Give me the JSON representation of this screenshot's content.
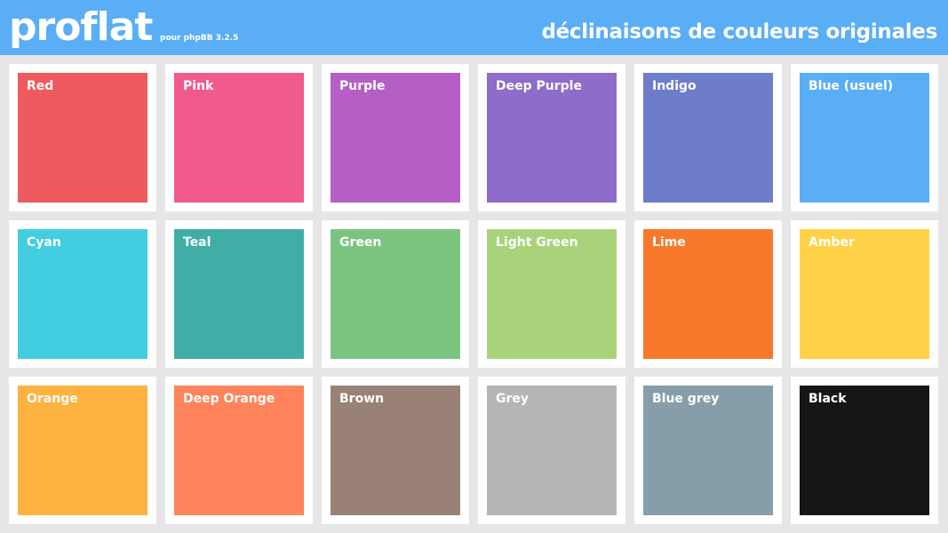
{
  "header": {
    "logo": "proflat",
    "subtitle": "pour phpBB 3.2.5",
    "title": "déclinaisons de couleurs originales",
    "background": "#5aaef6"
  },
  "swatches": [
    {
      "label": "Red",
      "color": "#ee5a5d"
    },
    {
      "label": "Pink",
      "color": "#f05a8c"
    },
    {
      "label": "Purple",
      "color": "#b45ec6"
    },
    {
      "label": "Deep Purple",
      "color": "#8e6cc9"
    },
    {
      "label": "Indigo",
      "color": "#6e7dca"
    },
    {
      "label": "Blue (usuel)",
      "color": "#5aaef6"
    },
    {
      "label": "Cyan",
      "color": "#42cde0"
    },
    {
      "label": "Teal",
      "color": "#40aea7"
    },
    {
      "label": "Green",
      "color": "#7bc47f"
    },
    {
      "label": "Light Green",
      "color": "#a9d37a"
    },
    {
      "label": "Lime",
      "color": "#f7782a"
    },
    {
      "label": "Amber",
      "color": "#ffd147"
    },
    {
      "label": "Orange",
      "color": "#ffb240"
    },
    {
      "label": "Deep Orange",
      "color": "#ff835b"
    },
    {
      "label": "Brown",
      "color": "#9a8176"
    },
    {
      "label": "Grey",
      "color": "#b5b5b5"
    },
    {
      "label": "Blue grey",
      "color": "#869ea9"
    },
    {
      "label": "Black",
      "color": "#161616"
    }
  ]
}
